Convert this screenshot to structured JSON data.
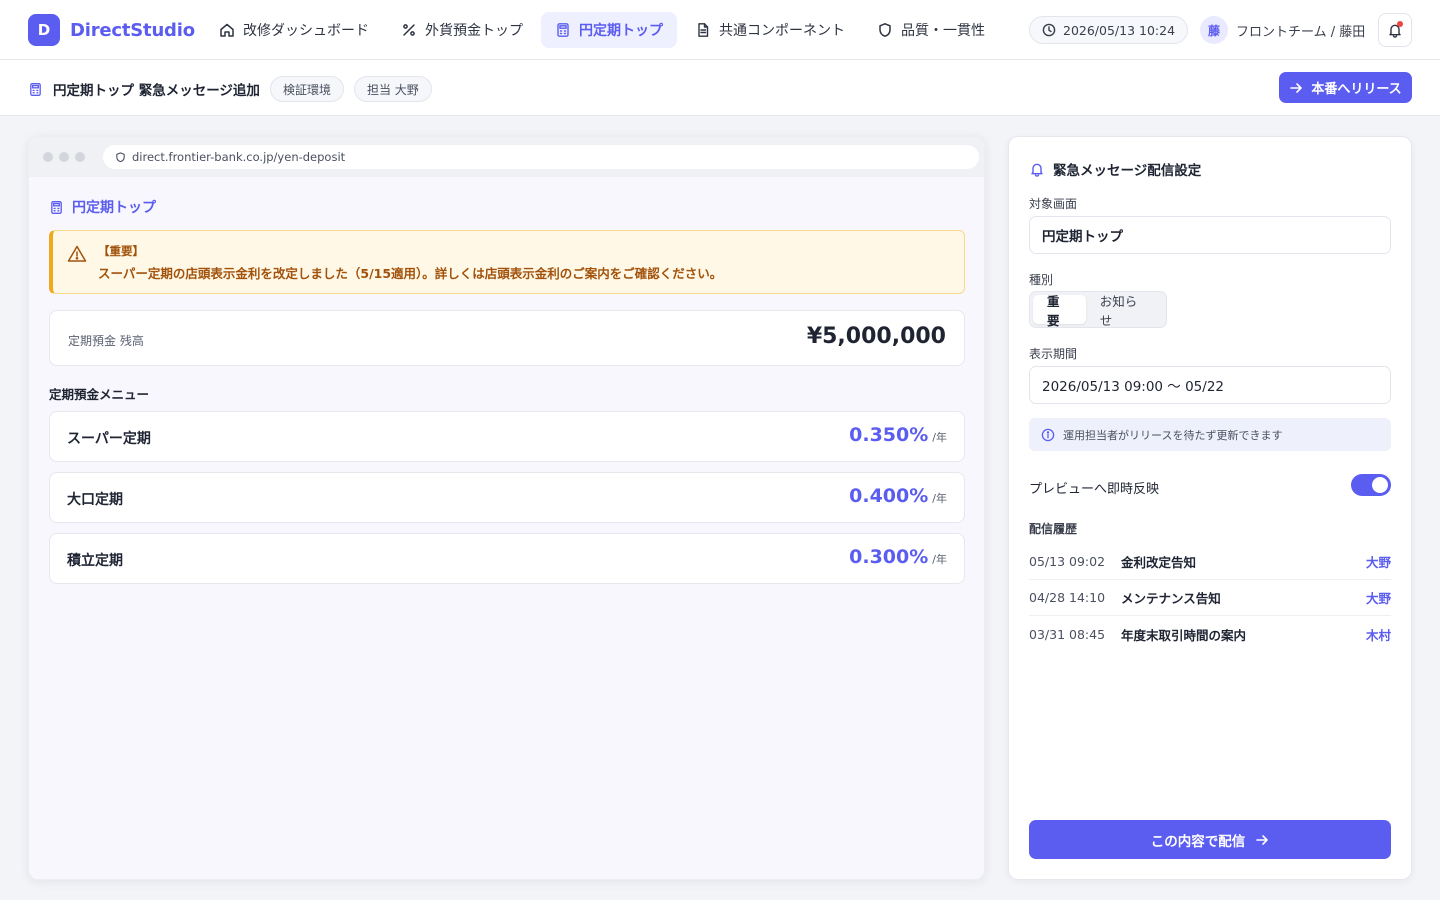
{
  "brand": {
    "logo_letter": "D",
    "name": "DirectStudio"
  },
  "nav": {
    "tabs": [
      {
        "label": "改修ダッシュボード",
        "icon": "home-icon"
      },
      {
        "label": "外貨預金トップ",
        "icon": "percent-icon"
      },
      {
        "label": "円定期トップ",
        "icon": "calculator-icon",
        "active": true
      },
      {
        "label": "共通コンポーネント",
        "icon": "document-icon"
      },
      {
        "label": "品質・一貫性",
        "icon": "shield-icon"
      }
    ],
    "datetime": "2026/05/13 10:24",
    "user_initial": "藤",
    "user_name": "フロントチーム / 藤田"
  },
  "subheader": {
    "title": "円定期トップ 緊急メッセージ追加",
    "chips": [
      "検証環境",
      "担当 大野"
    ],
    "release_label": "本番へリリース"
  },
  "preview": {
    "url": "direct.frontier-bank.co.jp/yen-deposit",
    "page_title": "円定期トップ",
    "alert": {
      "tag": "【重要】",
      "text": "スーパー定期の店頭表示金利を改定しました（5/15適用）。詳しくは店頭表示金利のご案内をご確認ください。"
    },
    "balance": {
      "label": "定期預金 残高",
      "value": "¥5,000,000"
    },
    "menu_heading": "定期預金メニュー",
    "menu": [
      {
        "name": "スーパー定期",
        "rate": "0.350%",
        "unit": "/年"
      },
      {
        "name": "大口定期",
        "rate": "0.400%",
        "unit": "/年"
      },
      {
        "name": "積立定期",
        "rate": "0.300%",
        "unit": "/年"
      }
    ]
  },
  "panel": {
    "title": "緊急メッセージ配信設定",
    "target_label": "対象画面",
    "target_value": "円定期トップ",
    "type_label": "種別",
    "type_options": [
      "重要",
      "お知らせ"
    ],
    "period_label": "表示期間",
    "period_value": "2026/05/13 09:00 〜 05/22",
    "note": "運用担当者がリリースを待たず更新できます",
    "toggle_label": "プレビューへ即時反映",
    "toggle_on": true,
    "history_heading": "配信履歴",
    "history": [
      {
        "time": "05/13 09:02",
        "title": "金利改定告知",
        "who": "大野"
      },
      {
        "time": "04/28 14:10",
        "title": "メンテナンス告知",
        "who": "大野"
      },
      {
        "time": "03/31 08:45",
        "title": "年度末取引時間の案内",
        "who": "木村"
      }
    ],
    "send_label": "この内容で配信"
  },
  "colors": {
    "accent": "#5b5cf0",
    "alert_bg": "#fff8e6",
    "alert_text": "#a2520b"
  }
}
